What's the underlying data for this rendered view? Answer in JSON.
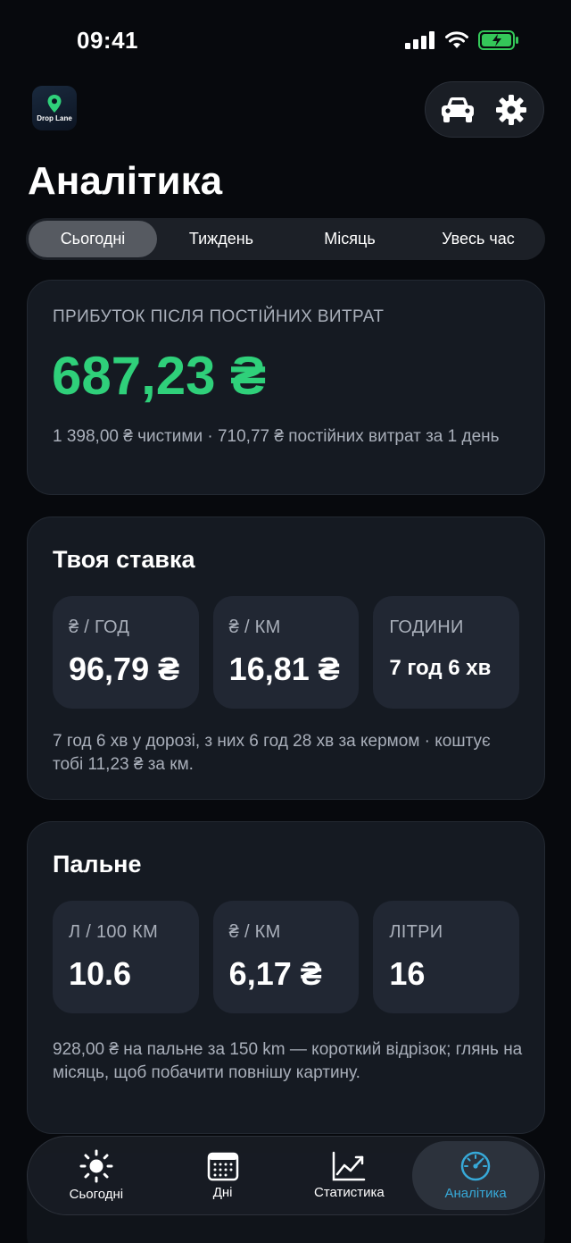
{
  "status_bar": {
    "time": "09:41"
  },
  "app": {
    "logo_text": "Drop Lane"
  },
  "header": {
    "title": "Аналітика"
  },
  "period_tabs": [
    "Сьогодні",
    "Тиждень",
    "Місяць",
    "Увесь час"
  ],
  "period_selected": "Сьогодні",
  "profit": {
    "label": "ПРИБУТОК ПІСЛЯ ПОСТІЙНИХ ВИТРАТ",
    "value": "687,23 ₴",
    "note": "1 398,00 ₴ чистими · 710,77 ₴ постійних витрат за 1 день"
  },
  "rate": {
    "title": "Твоя ставка",
    "stats": [
      {
        "label": "₴ / ГОД",
        "value": "96,79 ₴"
      },
      {
        "label": "₴ / КМ",
        "value": "16,81 ₴"
      },
      {
        "label": "ГОДИНИ",
        "value": "7 год 6 хв"
      }
    ],
    "note": "7 год 6 хв у дорозі, з них 6 год 28 хв за кермом · коштує тобі 11,23 ₴ за км."
  },
  "fuel": {
    "title": "Пальне",
    "stats": [
      {
        "label": "Л / 100 КМ",
        "value": "10.6"
      },
      {
        "label": "₴ / КМ",
        "value": "6,17 ₴"
      },
      {
        "label": "ЛІТРИ",
        "value": "16"
      }
    ],
    "note": "928,00 ₴ на пальне за 150 km — короткий відрізок; глянь на місяць, щоб побачити повнішу картину."
  },
  "tabbar": {
    "items": [
      {
        "label": "Сьогодні",
        "icon": "sun-icon"
      },
      {
        "label": "Дні",
        "icon": "calendar-icon"
      },
      {
        "label": "Статистика",
        "icon": "chart-line-icon"
      },
      {
        "label": "Аналітика",
        "icon": "speedometer-icon"
      }
    ],
    "active": "Аналітика"
  },
  "colors": {
    "accent_green": "#2fd07a",
    "accent_blue": "#37a9d8",
    "battery_green": "#34c759"
  }
}
